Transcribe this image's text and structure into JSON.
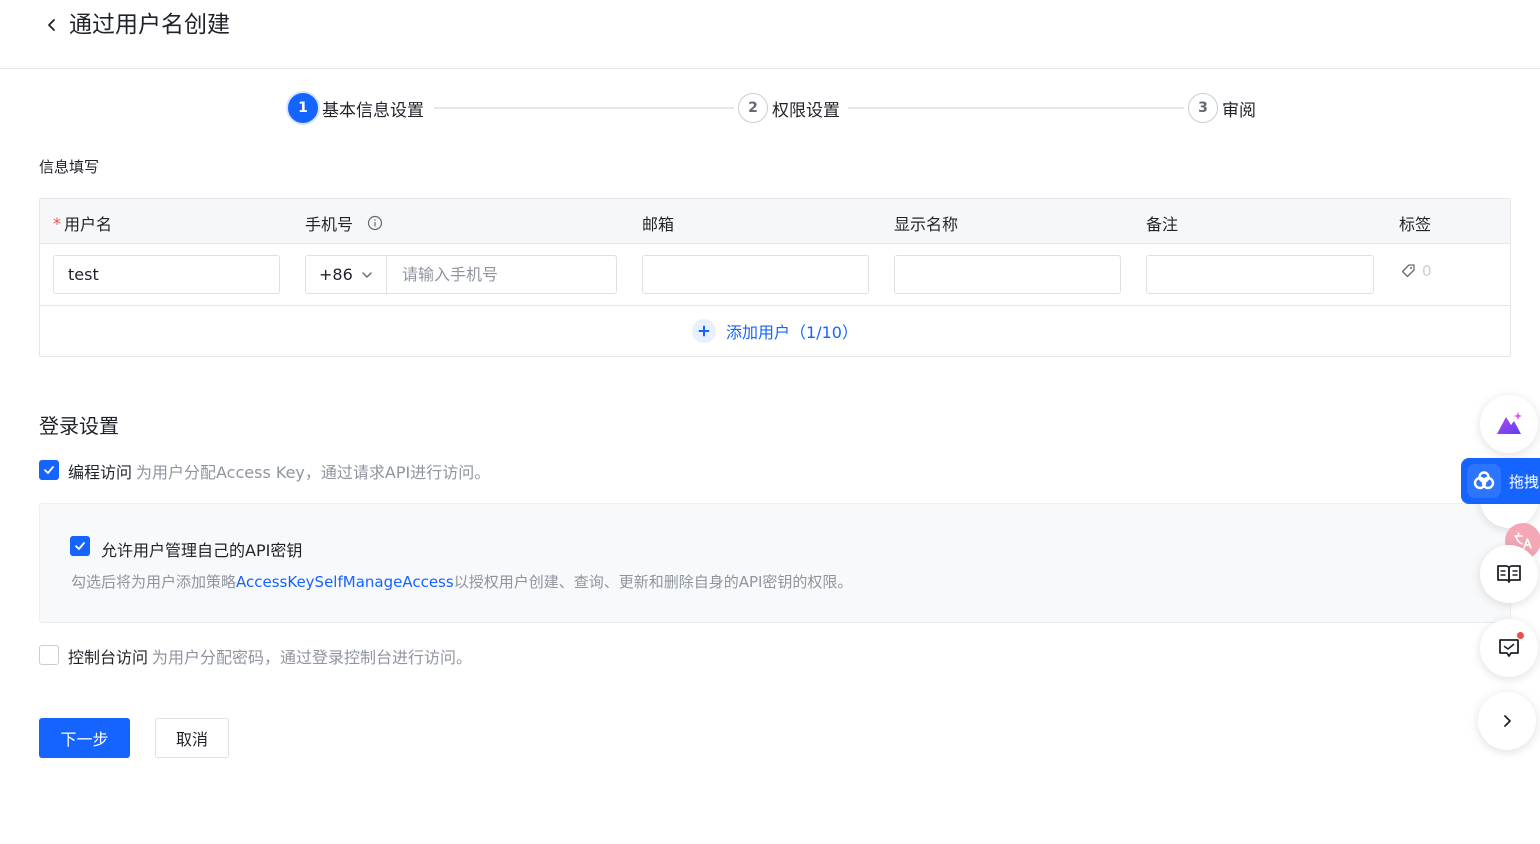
{
  "header": {
    "title": "通过用户名创建"
  },
  "steps": [
    {
      "num": "1",
      "label": "基本信息设置",
      "active": true
    },
    {
      "num": "2",
      "label": "权限设置",
      "active": false
    },
    {
      "num": "3",
      "label": "审阅",
      "active": false
    }
  ],
  "info_section": {
    "title": "信息填写",
    "columns": {
      "required_mark": "*",
      "username": "用户名",
      "phone": "手机号",
      "email": "邮箱",
      "display_name": "显示名称",
      "remark": "备注",
      "tags": "标签"
    },
    "row": {
      "username": "test",
      "phone_prefix": "+86",
      "phone_placeholder": "请输入手机号",
      "email": "",
      "display_name": "",
      "remark": "",
      "tag_count": "0"
    },
    "add_user_label": "添加用户（1/10）"
  },
  "login_settings": {
    "title": "登录设置",
    "programmatic": {
      "checked": true,
      "title": "编程访问",
      "desc": "为用户分配Access Key，通过请求API进行访问。"
    },
    "self_manage": {
      "checked": true,
      "title": "允许用户管理自己的API密钥",
      "desc_prefix": "勾选后将为用户添加策略",
      "policy_link": "AccessKeySelfManageAccess",
      "desc_suffix": "以授权用户创建、查询、更新和删除自身的API密钥的权限。"
    },
    "console": {
      "checked": false,
      "title": "控制台访问",
      "desc": "为用户分配密码，通过登录控制台进行访问。"
    }
  },
  "actions": {
    "next": "下一步",
    "cancel": "取消"
  },
  "floating": {
    "drag_label": "拖拽"
  },
  "colors": {
    "primary": "#1664ff",
    "danger": "#f54a45",
    "muted": "#8f959e"
  }
}
